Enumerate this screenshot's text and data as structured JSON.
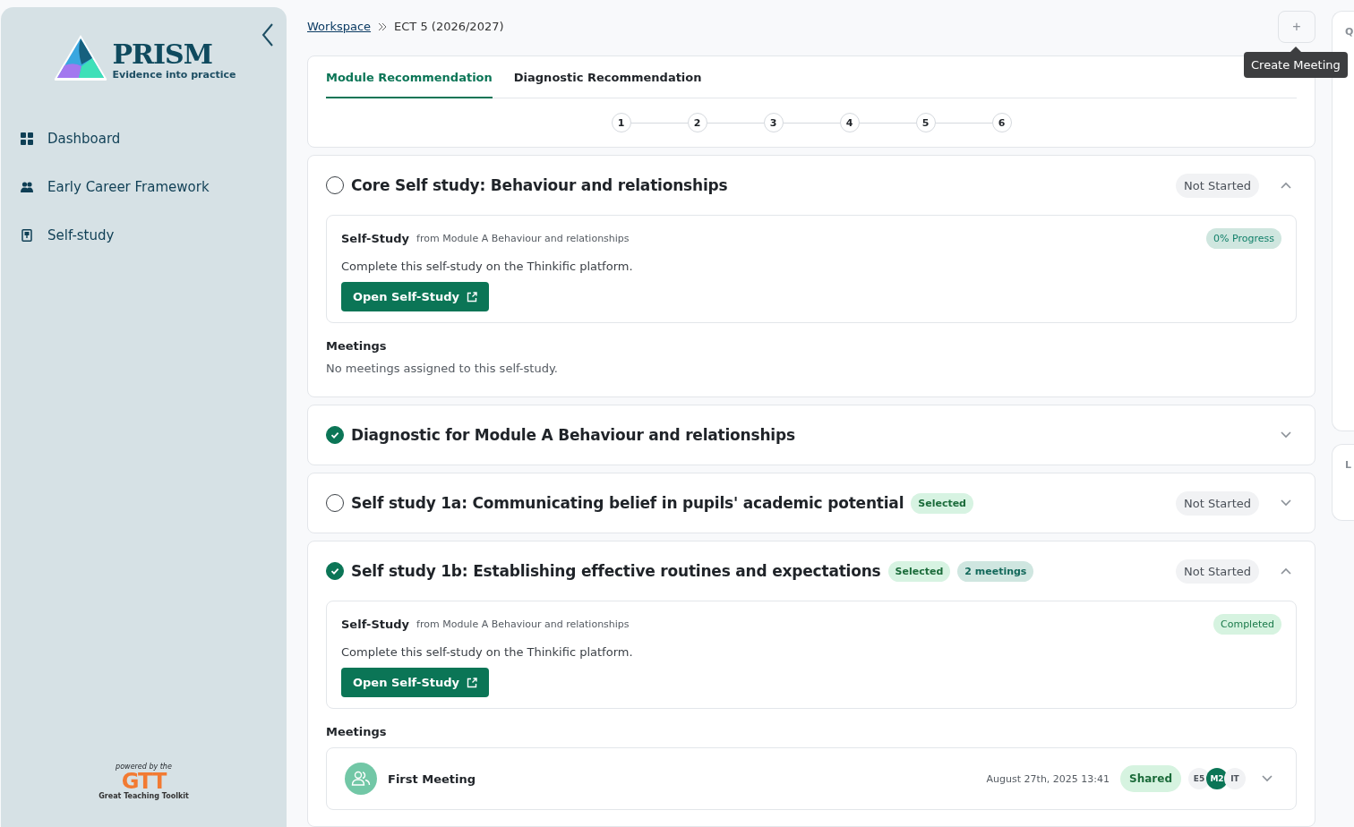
{
  "sidebar": {
    "logo": {
      "name": "PRISM",
      "tagline": "Evidence into practice"
    },
    "items": [
      {
        "label": "Dashboard",
        "selected": false
      },
      {
        "label": "Early Career Framework",
        "selected": false
      },
      {
        "label": "Self-study",
        "selected": false
      }
    ],
    "footer": {
      "caption": "powered by the",
      "mark": "GTT",
      "name": "Great Teaching Toolkit"
    }
  },
  "breadcrumb": [
    {
      "label": "Workspace",
      "kind": "link"
    },
    {
      "label": "ECT 5 (2026/2027)",
      "kind": "current"
    }
  ],
  "create_meeting": {
    "icon": "+",
    "tooltip": "Create Meeting"
  },
  "tabs": [
    {
      "label": "Module Recommendation",
      "selected": true
    },
    {
      "label": "Diagnostic Recommendation",
      "selected": false
    }
  ],
  "steps": [
    "1",
    "2",
    "3",
    "4",
    "5",
    "6"
  ],
  "modules": [
    {
      "title": "Core Self study: Behaviour and relationships",
      "checked": false,
      "status": "Not Started",
      "expanded": true,
      "self_study": {
        "label": "Self-Study",
        "source": "from Module A Behaviour and relationships",
        "progress": {
          "kind": "progress",
          "text": "0% Progress"
        },
        "description": "Complete this self-study on the Thinkific platform.",
        "button": "Open Self-Study"
      },
      "meetings_heading": "Meetings",
      "meetings_empty": "No meetings assigned to this self-study."
    },
    {
      "title": "Diagnostic for Module A Behaviour and relationships",
      "checked": true,
      "expanded": false
    },
    {
      "title": "Self study 1a: Communicating belief in pupils' academic potential",
      "checked": false,
      "badges": [
        {
          "kind": "selected",
          "text": "Selected"
        }
      ],
      "status": "Not Started",
      "expanded": false
    },
    {
      "title": "Self study 1b: Establishing effective routines and expectations",
      "checked": true,
      "badges": [
        {
          "kind": "selected",
          "text": "Selected"
        },
        {
          "kind": "count",
          "text": "2 meetings"
        }
      ],
      "status": "Not Started",
      "expanded": true,
      "self_study": {
        "label": "Self-Study",
        "source": "from Module A Behaviour and relationships",
        "progress": {
          "kind": "completed",
          "text": "Completed"
        },
        "description": "Complete this self-study on the Thinkific platform.",
        "button": "Open Self-Study"
      },
      "meetings_heading": "Meetings",
      "meetings": [
        {
          "title": "First Meeting",
          "date": "August 27th, 2025 13:41",
          "status": "Shared",
          "expanded": false,
          "avatars": [
            {
              "initials": "E5",
              "color": "#f1f2f4"
            },
            {
              "initials": "M2",
              "color": "#0b7556"
            },
            {
              "initials": "IT",
              "color": "#f1f2f4"
            }
          ]
        }
      ]
    }
  ],
  "right_panel": [
    {
      "heading": "Q"
    },
    {
      "heading": "L"
    }
  ]
}
